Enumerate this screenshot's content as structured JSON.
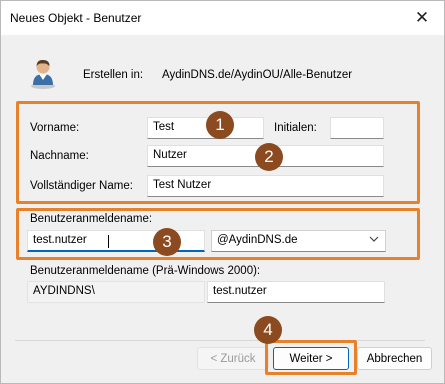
{
  "window": {
    "title": "Neues Objekt - Benutzer",
    "close_glyph": "✕"
  },
  "header": {
    "create_in_label": "Erstellen in:",
    "create_in_path": "AydinDNS.de/AydinOU/Alle-Benutzer"
  },
  "form": {
    "first_name_label": "Vorname:",
    "first_name_value": "Test",
    "initials_label": "Initialen:",
    "initials_value": "",
    "last_name_label": "Nachname:",
    "last_name_value": "Nutzer",
    "full_name_label": "Vollständiger Name:",
    "full_name_value": "Test Nutzer",
    "logon_name_label": "Benutzeranmeldename:",
    "logon_name_value": "test.nutzer",
    "domain_suffix": "@AydinDNS.de",
    "pre2000_label": "Benutzeranmeldename (Prä-Windows 2000):",
    "pre2000_domain": "AYDINDNS\\",
    "pre2000_value": "test.nutzer"
  },
  "badges": [
    "1",
    "2",
    "3",
    "4"
  ],
  "buttons": {
    "back": "< Zurück",
    "next": "Weiter >",
    "cancel": "Abbrechen"
  },
  "colors": {
    "highlight": "#e8822a",
    "badge": "#8b4a1f",
    "focus": "#0067c0"
  },
  "icons": {
    "user": "user-icon",
    "close": "close-icon",
    "dropdown": "chevron-down-icon"
  }
}
